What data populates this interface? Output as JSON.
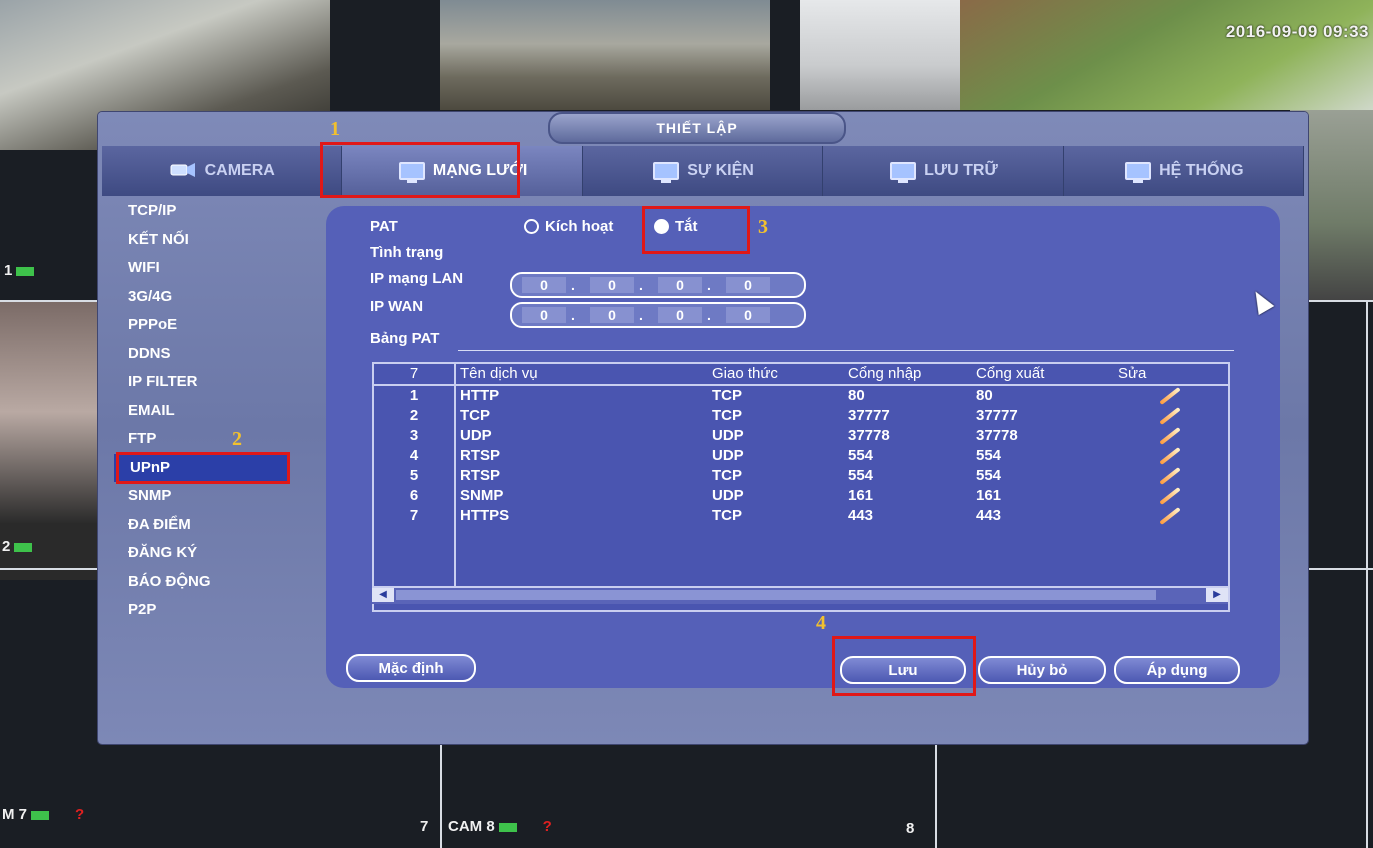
{
  "timestamp": "2016-09-09 09:33",
  "window_title": "THIẾT LẬP",
  "tabs": [
    {
      "label": "CAMERA",
      "icon": "camera-icon"
    },
    {
      "label": "MẠNG LƯỚI",
      "icon": "network-icon"
    },
    {
      "label": "SỰ KIỆN",
      "icon": "event-icon"
    },
    {
      "label": "LƯU TRỮ",
      "icon": "storage-icon"
    },
    {
      "label": "HỆ THỐNG",
      "icon": "system-icon"
    }
  ],
  "menu": [
    "TCP/IP",
    "KẾT NỐI",
    "WIFI",
    "3G/4G",
    "PPPoE",
    "DDNS",
    "IP FILTER",
    "EMAIL",
    "FTP",
    "UPnP",
    "SNMP",
    "ĐA ĐIỂM",
    "ĐĂNG KÝ",
    "BÁO ĐỘNG",
    "P2P"
  ],
  "form": {
    "pat_label": "PAT",
    "radio_enable": "Kích hoạt",
    "radio_disable": "Tắt",
    "status_label": "Tình trạng",
    "lan_ip_label": "IP mạng LAN",
    "wan_ip_label": "IP WAN",
    "lan_ip": [
      "0",
      "0",
      "0",
      "0"
    ],
    "wan_ip": [
      "0",
      "0",
      "0",
      "0"
    ],
    "pat_table_label": "Bảng PAT"
  },
  "table": {
    "headers": {
      "count": "7",
      "service": "Tên dịch vụ",
      "protocol": "Giao thức",
      "in_port": "Cổng nhập",
      "out_port": "Cổng xuất",
      "edit": "Sửa"
    },
    "rows": [
      {
        "idx": "1",
        "service": "HTTP",
        "protocol": "TCP",
        "in_port": "80",
        "out_port": "80"
      },
      {
        "idx": "2",
        "service": "TCP",
        "protocol": "TCP",
        "in_port": "37777",
        "out_port": "37777"
      },
      {
        "idx": "3",
        "service": "UDP",
        "protocol": "UDP",
        "in_port": "37778",
        "out_port": "37778"
      },
      {
        "idx": "4",
        "service": "RTSP",
        "protocol": "UDP",
        "in_port": "554",
        "out_port": "554"
      },
      {
        "idx": "5",
        "service": "RTSP",
        "protocol": "TCP",
        "in_port": "554",
        "out_port": "554"
      },
      {
        "idx": "6",
        "service": "SNMP",
        "protocol": "UDP",
        "in_port": "161",
        "out_port": "161"
      },
      {
        "idx": "7",
        "service": "HTTPS",
        "protocol": "TCP",
        "in_port": "443",
        "out_port": "443"
      }
    ]
  },
  "buttons": {
    "default": "Mặc định",
    "save": "Lưu",
    "cancel": "Hủy bỏ",
    "apply": "Áp dụng"
  },
  "annotations": [
    "1",
    "2",
    "3",
    "4"
  ],
  "cam_labels": {
    "cam1": "1",
    "cam2": "2",
    "cam7": "M 7",
    "cam7_num": "7",
    "cam8": "CAM 8",
    "cam8_num": "8"
  },
  "colors": {
    "highlight": "#e01818",
    "active_menu": "#2b3fa8",
    "annotation": "#f2c12e"
  }
}
